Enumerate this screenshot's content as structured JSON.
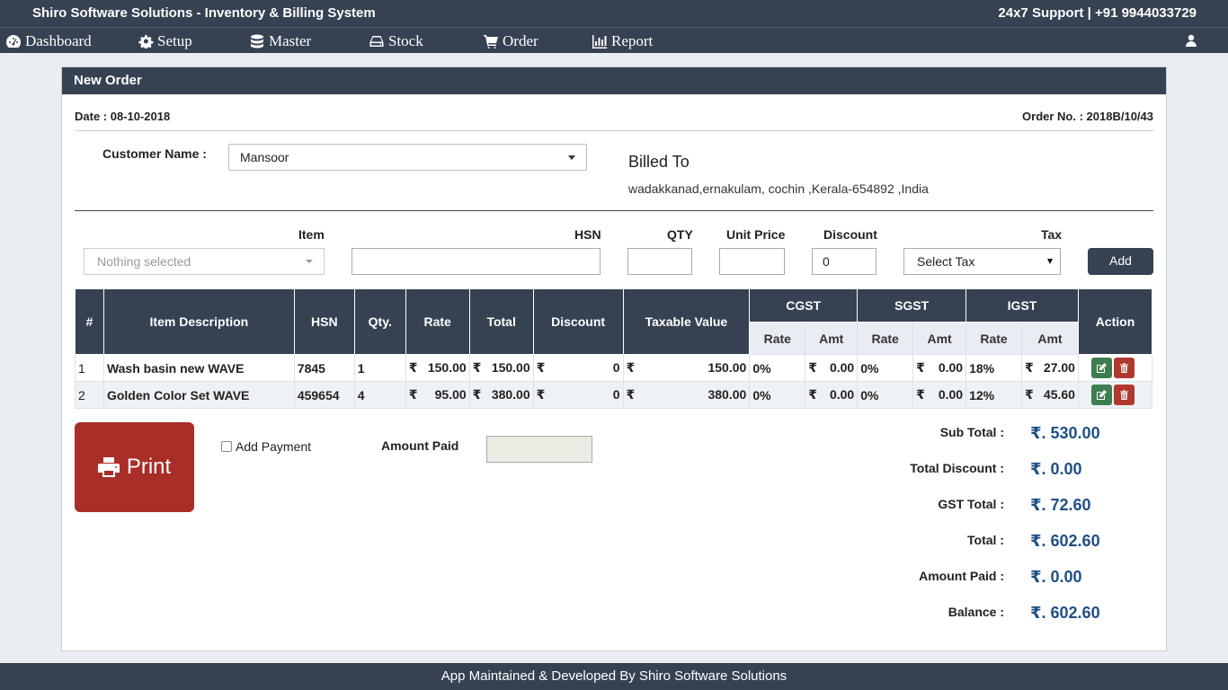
{
  "app": {
    "title": "Shiro Software Solutions - Inventory & Billing System",
    "support": "24x7 Support | +91 9944033729"
  },
  "nav": [
    {
      "label": "Dashboard",
      "icon": "dashboard-icon"
    },
    {
      "label": "Setup",
      "icon": "gear-icon"
    },
    {
      "label": "Master",
      "icon": "database-icon"
    },
    {
      "label": "Stock",
      "icon": "hdd-icon"
    },
    {
      "label": "Order",
      "icon": "cart-icon"
    },
    {
      "label": "Report",
      "icon": "bar-chart-icon"
    }
  ],
  "panel": {
    "title": "New Order",
    "date": "Date : 08-10-2018",
    "order_no": "Order No. : 2018B/10/43"
  },
  "customer": {
    "label": "Customer Name :",
    "value": "Mansoor",
    "billed_to_title": "Billed To",
    "address": "wadakkanad,ernakulam, cochin ,Kerala-654892 ,India"
  },
  "form": {
    "item_label": "Item",
    "item_placeholder": "Nothing selected",
    "hsn_label": "HSN",
    "qty_label": "QTY",
    "unit_price_label": "Unit Price",
    "discount_label": "Discount",
    "discount_value": "0",
    "tax_label": "Tax",
    "tax_value": "Select Tax",
    "add_label": "Add"
  },
  "table": {
    "headers": {
      "num": "#",
      "desc": "Item Description",
      "hsn": "HSN",
      "qty": "Qty.",
      "rate": "Rate",
      "total": "Total",
      "discount": "Discount",
      "taxable": "Taxable Value",
      "cgst": "CGST",
      "sgst": "SGST",
      "igst": "IGST",
      "action": "Action",
      "sub_rate": "Rate",
      "sub_amt": "Amt"
    },
    "currency": "₹",
    "rows": [
      {
        "num": "1",
        "desc": "Wash basin new WAVE",
        "hsn": "7845",
        "qty": "1",
        "rate": "150.00",
        "total": "150.00",
        "discount": "0",
        "taxable": "150.00",
        "cgst_rate": "0%",
        "cgst_amt": "0.00",
        "sgst_rate": "0%",
        "sgst_amt": "0.00",
        "igst_rate": "18%",
        "igst_amt": "27.00"
      },
      {
        "num": "2",
        "desc": "Golden Color Set WAVE",
        "hsn": "459654",
        "qty": "4",
        "rate": "95.00",
        "total": "380.00",
        "discount": "0",
        "taxable": "380.00",
        "cgst_rate": "0%",
        "cgst_amt": "0.00",
        "sgst_rate": "0%",
        "sgst_amt": "0.00",
        "igst_rate": "12%",
        "igst_amt": "45.60"
      }
    ]
  },
  "actions": {
    "print_label": "Print",
    "add_payment_label": "Add Payment",
    "amount_paid_label": "Amount Paid"
  },
  "summary": {
    "sub_total_label": "Sub Total :",
    "sub_total": "₹. 530.00",
    "total_discount_label": "Total Discount :",
    "total_discount": "₹. 0.00",
    "gst_total_label": "GST Total :",
    "gst_total": "₹. 72.60",
    "total_label": "Total :",
    "total": "₹. 602.60",
    "amount_paid_label": "Amount Paid :",
    "amount_paid": "₹. 0.00",
    "balance_label": "Balance :",
    "balance": "₹. 602.60"
  },
  "footer": "App Maintained & Developed By Shiro Software Solutions",
  "colors": {
    "primary": "#364152",
    "danger": "#a82e27",
    "success": "#3e7d4f",
    "value_blue": "#1f4f85"
  }
}
